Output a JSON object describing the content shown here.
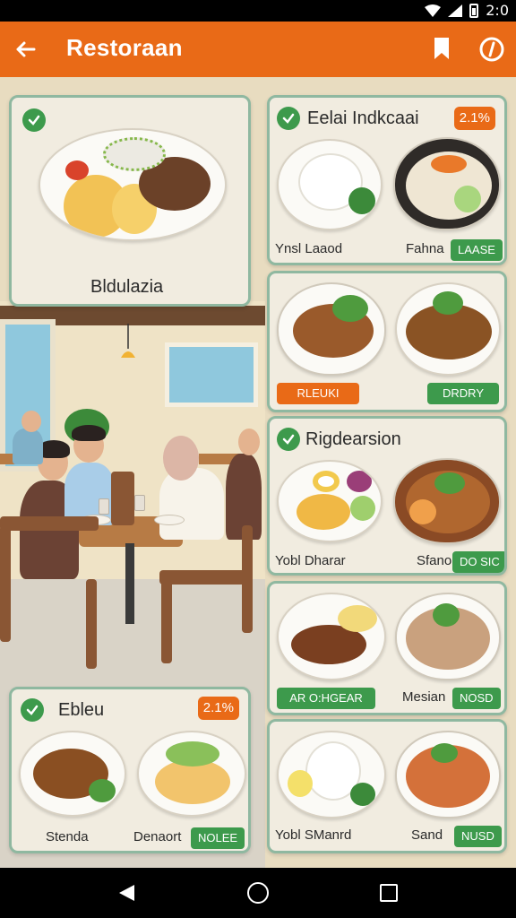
{
  "status_bar": {
    "time": "2:0"
  },
  "app_bar": {
    "title": "Restoraan",
    "back_icon": "arrow-left-icon",
    "bookmark_icon": "bookmark-icon",
    "info_icon": "info-circle-icon"
  },
  "featured": {
    "title": "Bldulazia"
  },
  "cards": [
    {
      "title": "Eelai Indkcaai",
      "badge": "2.1%",
      "left_label": "Ynsl Laaod",
      "right_label": "Fahna",
      "right_tag": "LAASE"
    },
    {
      "left_tag": "RLEUKI",
      "right_tag": "DRDRY"
    },
    {
      "title": "Rigdearsion",
      "left_label": "Yobl Dharar",
      "right_label": "Sfano",
      "right_tag": "DO SIC"
    },
    {
      "left_tag": "AR O:HGEAR",
      "right_label": "Mesian",
      "right_tag": "NOSD"
    },
    {
      "left_label": "Yobl SManrd",
      "right_label": "Sand",
      "right_tag": "NUSD"
    }
  ],
  "bottom_card": {
    "title": "Ebleu",
    "badge": "2.1%",
    "left_label": "Stenda",
    "right_label": "Denaort",
    "right_tag": "NOLEE"
  },
  "colors": {
    "accent": "#e96a17",
    "green": "#3d9a4c",
    "card_border": "#8fb8a0"
  }
}
